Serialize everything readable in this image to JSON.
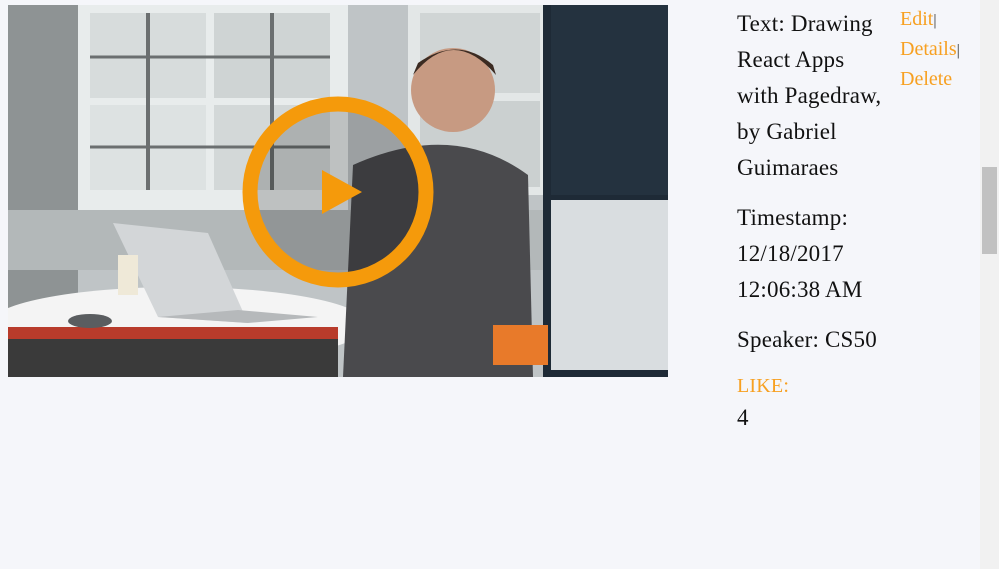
{
  "video": {
    "play_icon": "play-icon",
    "accent_color": "#f7a021"
  },
  "details": {
    "text": "Text: Drawing React Apps with Pagedraw, by Gabriel Guimaraes",
    "timestamp": "Timestamp: 12/18/2017 12:06:38 AM",
    "speaker": "Speaker: CS50",
    "like_label": "LIKE:",
    "like_count": "4"
  },
  "actions": {
    "edit": "Edit",
    "details": "Details",
    "delete": "Delete",
    "separator": "|"
  },
  "colors": {
    "link": "#f7a021",
    "background": "#f5f6fa",
    "text": "#111111"
  }
}
